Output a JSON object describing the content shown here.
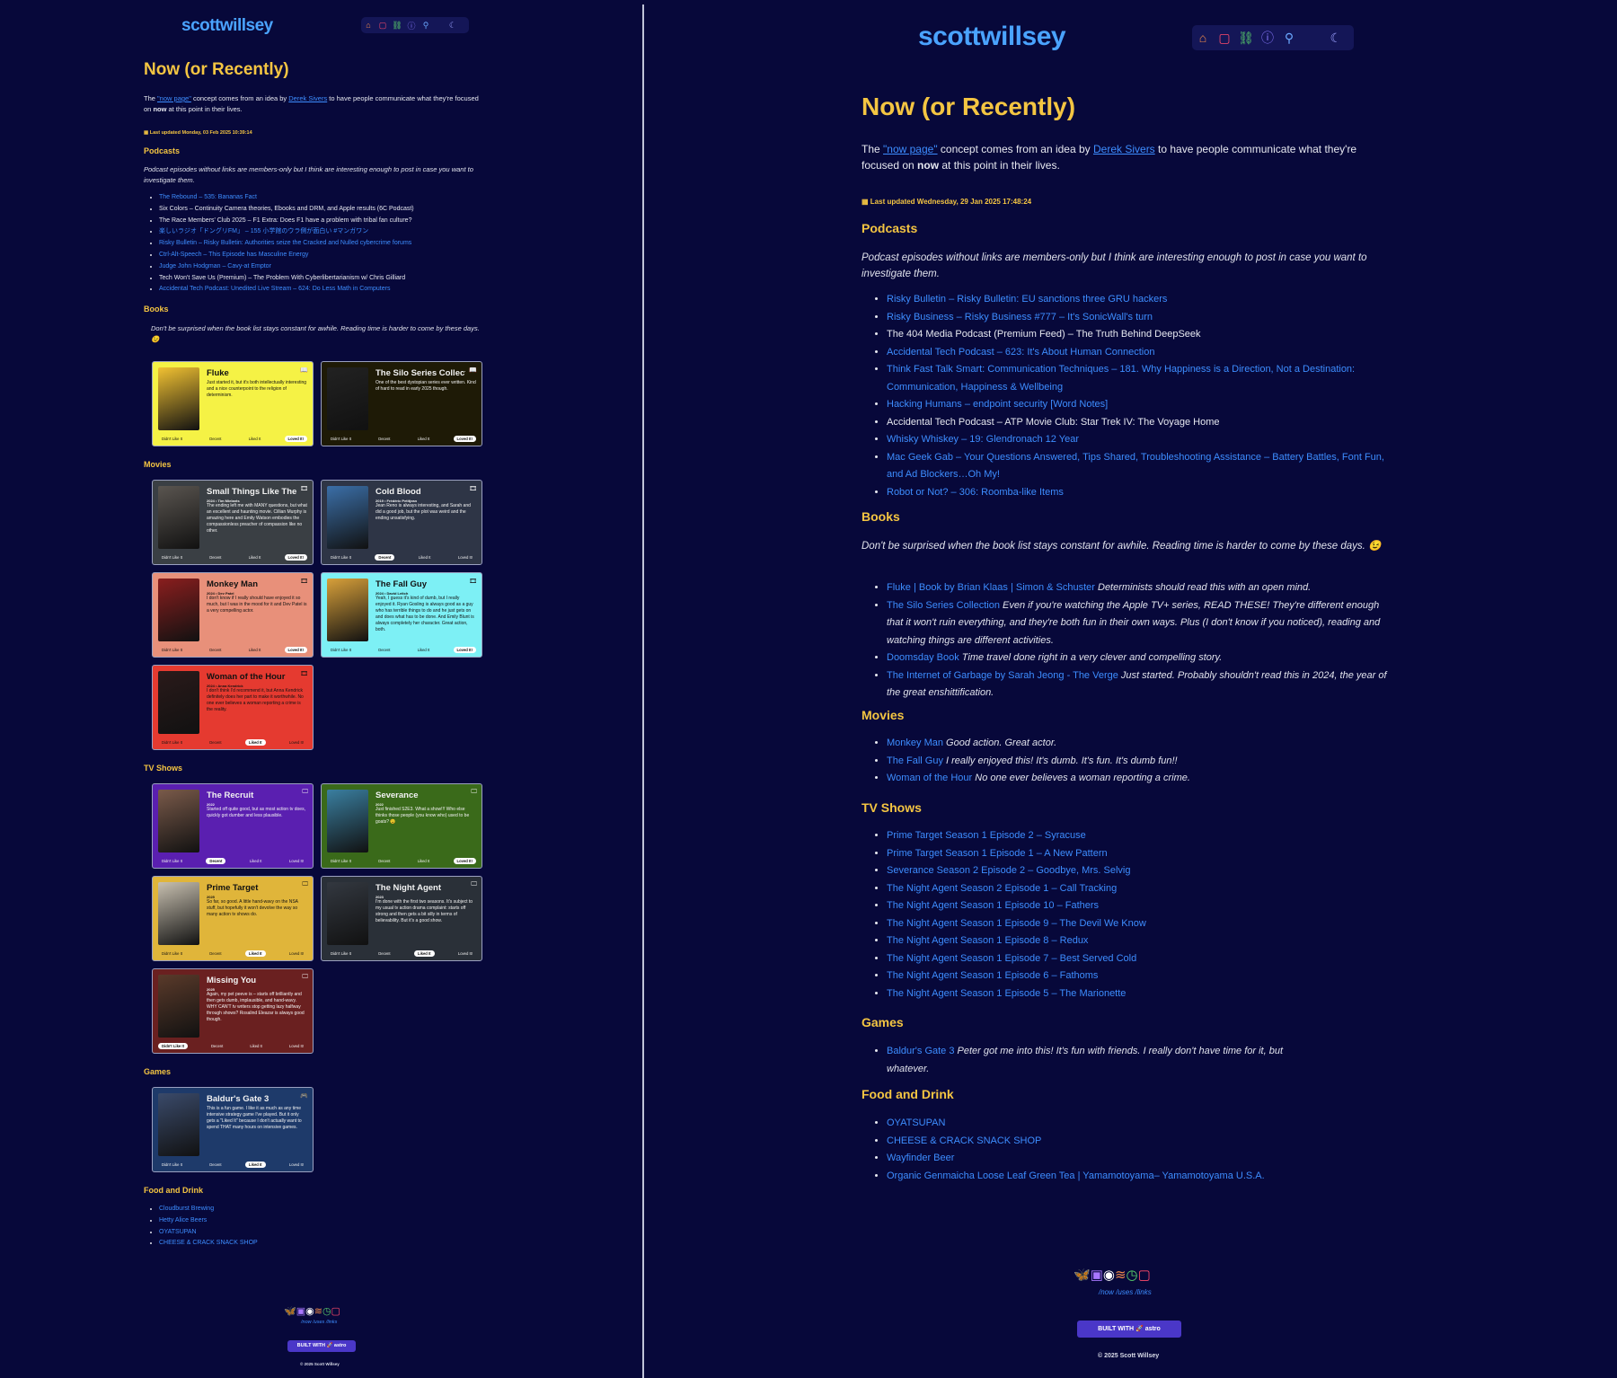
{
  "site": {
    "logo": "scottwillsey"
  },
  "nav": {
    "icons": [
      "home-icon",
      "chat-icon",
      "link-icon",
      "info-icon",
      "search-icon",
      "moon-icon"
    ]
  },
  "page": {
    "title": "Now (or Recently)"
  },
  "intro": {
    "pre": "The ",
    "link1": "\"now page\"",
    "mid": " concept comes from an idea by ",
    "link2": "Derek Sivers",
    "post": " to have people communicate what they're focused on ",
    "bold": "now",
    "end": " at this point in their lives."
  },
  "left": {
    "updated": "Last updated Monday, 03 Feb 2025 10:39:14",
    "podcasts_heading": "Podcasts",
    "podcasts_note": "Podcast episodes without links are members-only but I think are interesting enough to post in case you want to investigate them.",
    "podcasts": [
      {
        "text": "The Rebound – 535: Bananas Fact",
        "link": true
      },
      {
        "text": "Six Colors – Continuity Camera theories, Ebooks and DRM, and Apple results (6C Podcast)",
        "link": false
      },
      {
        "text": "The Race Members' Club 2025 – F1 Extra: Does F1 have a problem with tribal fan culture?",
        "link": false
      },
      {
        "text": "楽しいラジオ「ドングリFM」 – 155 小学館のウラ側が面白い #マンガワン",
        "link": true
      },
      {
        "text": "Risky Bulletin – Risky Bulletin: Authorities seize the Cracked and Nulled cybercrime forums",
        "link": true
      },
      {
        "text": "Ctrl-Alt-Speech – This Episode has Masculine Energy",
        "link": true
      },
      {
        "text": "Judge John Hodgman – Cavy-at Emptor",
        "link": true
      },
      {
        "text": "Tech Won't Save Us (Premium) – The Problem With Cyberlibertarianism w/ Chris Gilliard",
        "link": false
      },
      {
        "text": "Accidental Tech Podcast: Unedited Live Stream – 624: Do Less Math in Computers",
        "link": true
      }
    ],
    "books_heading": "Books",
    "books_note": "Don't be surprised when the book list stays constant for awhile. Reading time is harder to come by these days. 😉",
    "rating_labels": [
      "Didn't Like It",
      "Decent",
      "Liked It",
      "Loved It!"
    ],
    "books": [
      {
        "title": "Fluke",
        "sub": "",
        "desc": "Just started it, but it's both intellectually interesting and a nice counterpoint to the religion of determinism.",
        "bg": "#f5f245",
        "fg": "#111111",
        "poster": "#f2c232",
        "rating": 3,
        "icon": "📖"
      },
      {
        "title": "The Silo Series Collection",
        "sub": "",
        "desc": "One of the best dystopian series ever written. Kind of hard to read in early 2025 though.",
        "bg": "#1e1a06",
        "fg": "#f2f2f2",
        "poster": "#222222",
        "rating": 3,
        "icon": "📖"
      }
    ],
    "movies_heading": "Movies",
    "movies": [
      {
        "title": "Small Things Like These",
        "sub": "2024 • Tim Mielants",
        "desc": "The ending left me with MANY questions, but what an excellent and haunting movie. Cillian Murphy is amazing here and Emily Watson embodies the compassionless preacher of compassion like no other.",
        "bg": "#3a3f44",
        "fg": "#f2f2f2",
        "poster": "#5a5550",
        "rating": 3,
        "icon": "🎞"
      },
      {
        "title": "Cold Blood",
        "sub": "2019 • Frédéric Petitjean",
        "desc": "Jean Reno is always interesting, and Sarah and did a good job, but the plot was weird and the ending unsatisfying.",
        "bg": "#2e3546",
        "fg": "#f2f2f2",
        "poster": "#3b6fa8",
        "rating": 1,
        "icon": "🎞"
      },
      {
        "title": "Monkey Man",
        "sub": "2024 • Dev Patel",
        "desc": "I don't know if I really should have enjoyed it so much, but I was in the mood for it and Dev Patel is a very compelling actor.",
        "bg": "#e8907a",
        "fg": "#111111",
        "poster": "#8a1e1e",
        "rating": 3,
        "icon": "🎞"
      },
      {
        "title": "The Fall Guy",
        "sub": "2024 • David Leitch",
        "desc": "Yeah, I guess it's kind of dumb, but I really enjoyed it. Ryan Gosling is always good as a guy who has terrible things to do and he just gets on and does what has to be done. And Emily Blunt is always completely her character. Great action, both.",
        "bg": "#7df0f5",
        "fg": "#111111",
        "poster": "#d8a03a",
        "rating": 3,
        "icon": "🎞"
      },
      {
        "title": "Woman of the Hour",
        "sub": "2024 • Anna Kendrick",
        "desc": "I don't think I'd recommend it, but Anna Kendrick definitely does her part to make it worthwhile. No one ever believes a woman reporting a crime is the reality.",
        "bg": "#e53a30",
        "fg": "#111111",
        "poster": "#2a1a1a",
        "rating": 2,
        "icon": "🎞"
      }
    ],
    "tv_heading": "TV Shows",
    "tv": [
      {
        "title": "The Recruit",
        "sub": "2022",
        "desc": "Started off quite good, but as most action tv does, quickly got dumber and less plausible.",
        "bg": "#5a1fb0",
        "fg": "#f2f2f2",
        "poster": "#7a5a4a",
        "rating": 1,
        "icon": "🖵"
      },
      {
        "title": "Severance",
        "sub": "2022",
        "desc": "Just finished S2E3. What a show!!! Who else thinks those people (you know who) used to be goats? 😉",
        "bg": "#3a6a1a",
        "fg": "#f2f2f2",
        "poster": "#3a7fa0",
        "rating": 3,
        "icon": "🖵"
      },
      {
        "title": "Prime Target",
        "sub": "2025",
        "desc": "So far, so good. A little hand-wavy on the NSA stuff, but hopefully it won't devolve the way so many action tv shows do.",
        "bg": "#e0b53a",
        "fg": "#111111",
        "poster": "#c8c0b0",
        "rating": 2,
        "icon": "🖵"
      },
      {
        "title": "The Night Agent",
        "sub": "2023",
        "desc": "I'm done with the first two seasons. It's subject to my usual tv action drama complaint: starts off strong and then gets a bit silly in terms of believability. But it's a good show.",
        "bg": "#2a3038",
        "fg": "#f2f2f2",
        "poster": "#333840",
        "rating": 2,
        "icon": "🖵"
      },
      {
        "title": "Missing You",
        "sub": "2025",
        "desc": "Again, my pet peeve is – starts off brilliantly and then gets dumb, implausible, and hand-wavy. WHY CAN'T tv writers stop getting lazy halfway through shows? Rosalind Eleazar is always good though.",
        "bg": "#6a2020",
        "fg": "#f2f2f2",
        "poster": "#5a3a2a",
        "rating": 0,
        "icon": "🖵"
      }
    ],
    "games_heading": "Games",
    "games": [
      {
        "title": "Baldur's Gate 3",
        "sub": "",
        "desc": "This is a fun game. I like it as much as any time intensive strategy game I've played. But it only gets a \"Liked It\" because I don't actually want to spend THAT many hours on intensive games.",
        "bg": "#1e3a6a",
        "fg": "#f2f2f2",
        "poster": "#3a4a6a",
        "rating": 2,
        "icon": "🎮"
      }
    ],
    "food_heading": "Food and Drink",
    "food": [
      "Cloudburst Brewing",
      "Hetty Alice Beers",
      "OYATSUPAN",
      "CHEESE & CRACK SNACK SHOP"
    ]
  },
  "right": {
    "updated": "Last updated Wednesday, 29 Jan 2025 17:48:24",
    "podcasts_heading": "Podcasts",
    "podcasts_note": "Podcast episodes without links are members-only but I think are interesting enough to post in case you want to investigate them.",
    "podcasts": [
      {
        "text": "Risky Bulletin – Risky Bulletin: EU sanctions three GRU hackers",
        "link": true
      },
      {
        "text": "Risky Business – Risky Business #777 – It's SonicWall's turn",
        "link": true
      },
      {
        "text": "The 404 Media Podcast (Premium Feed) – The Truth Behind DeepSeek",
        "link": false
      },
      {
        "text": "Accidental Tech Podcast – 623: It's About Human Connection",
        "link": true
      },
      {
        "text": "Think Fast Talk Smart: Communication Techniques – 181. Why Happiness is a Direction, Not a Destination: Communication, Happiness & Wellbeing",
        "link": true
      },
      {
        "text": "Hacking Humans – endpoint security [Word Notes]",
        "link": true
      },
      {
        "text": "Accidental Tech Podcast – ATP Movie Club: Star Trek IV: The Voyage Home",
        "link": false
      },
      {
        "text": "Whisky Whiskey – 19: Glendronach 12 Year",
        "link": true
      },
      {
        "text": "Mac Geek Gab – Your Questions Answered, Tips Shared, Troubleshooting Assistance – Battery Battles, Font Fun, and Ad Blockers…Oh My!",
        "link": true
      },
      {
        "text": "Robot or Not? – 306: Roomba-like Items",
        "link": true
      }
    ],
    "books_heading": "Books",
    "books_note": "Don't be surprised when the book list stays constant for awhile. Reading time is harder to come by these days. 😉",
    "books": [
      {
        "link": "Fluke | Book by Brian Klaas | Simon & Schuster",
        "note": " Determinists should read this with an open mind."
      },
      {
        "link": "The Silo Series Collection",
        "note": " Even if you're watching the Apple TV+ series, READ THESE! They're different enough that it won't ruin everything, and they're both fun in their own ways. Plus (I don't know if you noticed), reading and watching things are different activities."
      },
      {
        "link": "Doomsday Book",
        "note": " Time travel done right in a very clever and compelling story."
      },
      {
        "link": "The Internet of Garbage by Sarah Jeong - The Verge",
        "note": " Just started. Probably shouldn't read this in 2024, the year of the great enshittification."
      }
    ],
    "movies_heading": "Movies",
    "movies": [
      {
        "link": "Monkey Man",
        "note": " Good action. Great actor."
      },
      {
        "link": "The Fall Guy",
        "note": " I really enjoyed this! It's dumb. It's fun. It's dumb fun!!"
      },
      {
        "link": "Woman of the Hour",
        "note": " No one ever believes a woman reporting a crime."
      }
    ],
    "tv_heading": "TV Shows",
    "tv": [
      "Prime Target Season 1 Episode 2 – Syracuse",
      "Prime Target Season 1 Episode 1 – A New Pattern",
      "Severance Season 2 Episode 2 – Goodbye, Mrs. Selvig",
      "The Night Agent Season 2 Episode 1 – Call Tracking",
      "The Night Agent Season 1 Episode 10 – Fathers",
      "The Night Agent Season 1 Episode 9 – The Devil We Know",
      "The Night Agent Season 1 Episode 8 – Redux",
      "The Night Agent Season 1 Episode 7 – Best Served Cold",
      "The Night Agent Season 1 Episode 6 – Fathoms",
      "The Night Agent Season 1 Episode 5 – The Marionette"
    ],
    "games_heading": "Games",
    "games": [
      {
        "link": "Baldur's Gate 3",
        "note": " Peter got me into this! It's fun with friends. I really don't have time for it, but whatever."
      }
    ],
    "food_heading": "Food and Drink",
    "food": [
      "OYATSUPAN",
      "CHEESE & CRACK SNACK SHOP",
      "Wayfinder Beer",
      "Organic Genmaicha Loose Leaf Green Tea | Yamamotoyama– Yamamotoyama U.S.A."
    ]
  },
  "footer": {
    "links": "/now /uses /links",
    "built": "BUILT WITH 🚀 astro",
    "copyright": "© 2025 Scott Willsey"
  }
}
